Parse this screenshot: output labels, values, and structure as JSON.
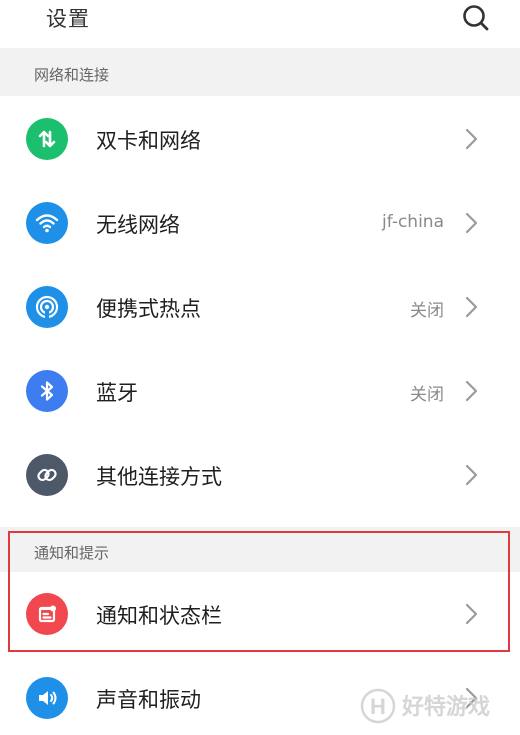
{
  "header": {
    "title": "设置",
    "search_icon": "search-icon"
  },
  "sections": [
    {
      "title": "网络和连接",
      "items": [
        {
          "label": "双卡和网络",
          "value": "",
          "icon": "data-transfer-icon",
          "icon_color": "#1bbf6e"
        },
        {
          "label": "无线网络",
          "value": "jf-china",
          "icon": "wifi-icon",
          "icon_color": "#1e90e8"
        },
        {
          "label": "便携式热点",
          "value": "关闭",
          "icon": "hotspot-icon",
          "icon_color": "#1e90e8"
        },
        {
          "label": "蓝牙",
          "value": "关闭",
          "icon": "bluetooth-icon",
          "icon_color": "#3d7df0"
        },
        {
          "label": "其他连接方式",
          "value": "",
          "icon": "link-icon",
          "icon_color": "#4d5869"
        }
      ]
    },
    {
      "title": "通知和提示",
      "items": [
        {
          "label": "通知和状态栏",
          "value": "",
          "icon": "notification-icon",
          "icon_color": "#f0484e"
        },
        {
          "label": "声音和振动",
          "value": "",
          "icon": "sound-icon",
          "icon_color": "#1e90e8"
        }
      ]
    }
  ],
  "watermark": {
    "text": "好特游戏",
    "logo_letter": "H"
  },
  "colors": {
    "highlight_border": "#e0393e",
    "section_bg": "#f2f2f2"
  }
}
